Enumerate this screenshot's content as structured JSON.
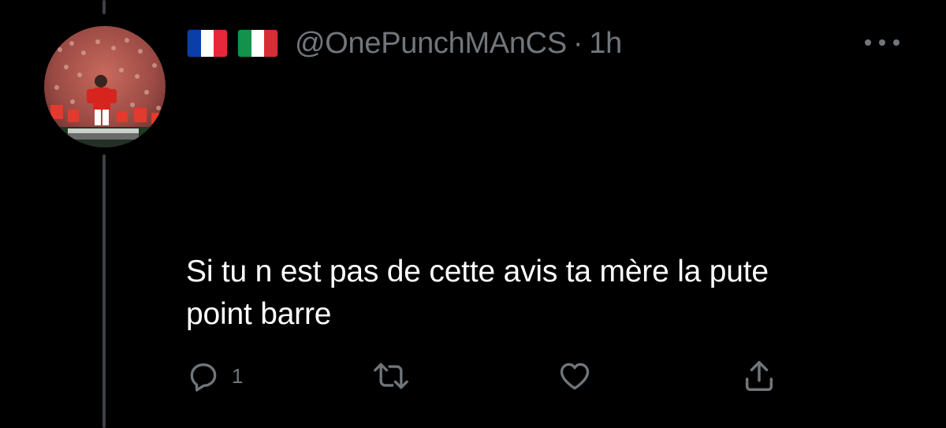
{
  "tweet": {
    "flags": [
      {
        "name": "france-flag",
        "stripes": [
          "#0a3ea8",
          "#ffffff",
          "#e8283a"
        ]
      },
      {
        "name": "italy-flag",
        "stripes": [
          "#12924a",
          "#ffffff",
          "#d62d36"
        ]
      }
    ],
    "handle": "@OnePunchMAnCS",
    "separator": "·",
    "time": "1h",
    "text_lines": [
      "Si tu n est pas de cette avis ta mère la pute",
      "point barre"
    ],
    "actions": {
      "reply_icon": "reply-icon",
      "reply_count": "1",
      "retweet_icon": "retweet-icon",
      "like_icon": "heart-icon",
      "share_icon": "share-icon"
    },
    "more_icon": "more-options-icon"
  },
  "colors": {
    "background": "#000000",
    "text": "#ffffff",
    "secondary": "#71767b",
    "thread_line": "#3e4246"
  }
}
